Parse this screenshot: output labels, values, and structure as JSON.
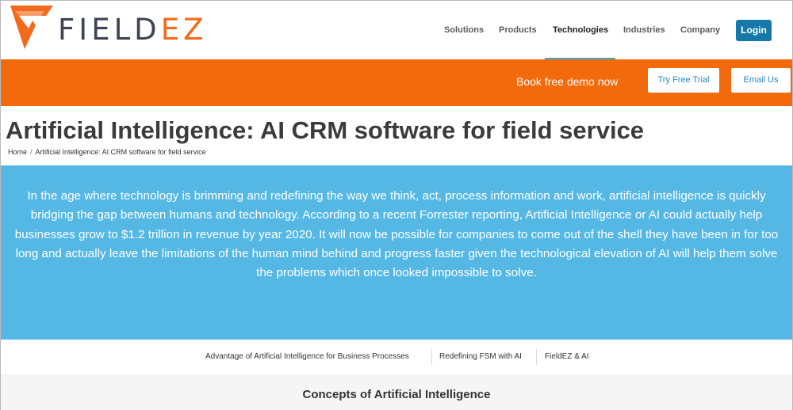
{
  "header": {
    "logo": {
      "text_main": "FIELD",
      "text_accent": "EZ"
    },
    "nav": [
      {
        "label": "Solutions",
        "active": false
      },
      {
        "label": "Products",
        "active": false
      },
      {
        "label": "Technologies",
        "active": true
      },
      {
        "label": "Industries",
        "active": false
      },
      {
        "label": "Company",
        "active": false
      }
    ],
    "login_label": "Login"
  },
  "cta": {
    "text": "Book free demo now",
    "trial_label": "Try Free Trial",
    "email_label": "Email Us"
  },
  "page": {
    "title": "Artificial Intelligence: AI CRM software for field service",
    "breadcrumb": [
      "Home",
      "Artificial Intelligence: AI CRM software for field service"
    ]
  },
  "intro": {
    "text": "In the age where technology is brimming and redefining the way we think, act, process information and work, artificial intelligence is quickly bridging the gap between humans and technology. According to a recent Forrester reporting, Artificial Intelligence or AI could actually help businesses grow to $1.2 trillion in revenue by year 2020. It will now be possible for companies to come out of the shell they have been in for too long and actually leave the limitations of the human mind behind and progress faster given the technological elevation of AI will help them solve the problems which once looked impossible to solve."
  },
  "subnav": [
    "Advantage of Artificial Intelligence for Business Processes",
    "Redefining FSM with AI",
    "FieldEZ & AI"
  ],
  "concepts": {
    "title": "Concepts of Artificial Intelligence"
  },
  "colors": {
    "brand_orange": "#f26a0c",
    "intro_blue": "#55b8e4",
    "login_blue": "#1678a8",
    "active_underline": "#39a9c9"
  }
}
